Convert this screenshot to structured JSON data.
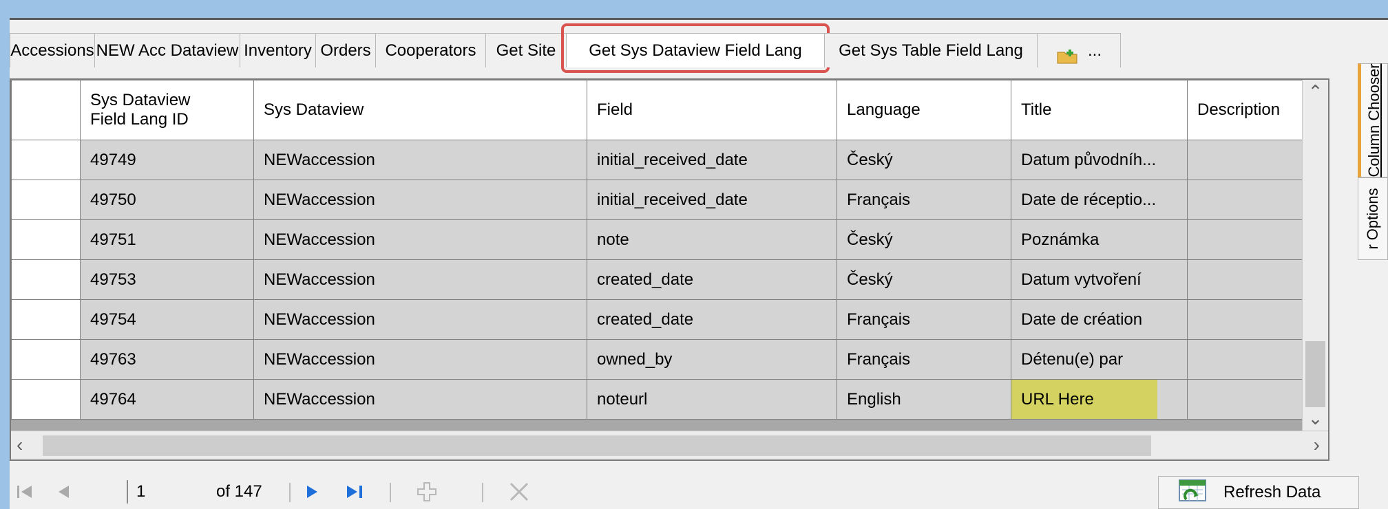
{
  "tabs": [
    {
      "label": "Accessions",
      "active": false
    },
    {
      "label": "NEW Acc Dataview",
      "active": false
    },
    {
      "label": "Inventory",
      "active": false
    },
    {
      "label": "Orders",
      "active": false
    },
    {
      "label": "Cooperators",
      "active": false
    },
    {
      "label": "Get Site",
      "active": false
    },
    {
      "label": "Get Sys Dataview Field Lang",
      "active": true
    },
    {
      "label": "Get Sys Table Field Lang",
      "active": false
    }
  ],
  "tab_overflow_label": "...",
  "grid": {
    "columns": [
      "Sys Dataview\nField Lang ID",
      "Sys Dataview",
      "Field",
      "Language",
      "Title",
      "Description"
    ],
    "rows": [
      [
        "49749",
        "NEWaccession",
        "initial_received_date",
        "Český",
        "Datum původníh...",
        ""
      ],
      [
        "49750",
        "NEWaccession",
        "initial_received_date",
        "Français",
        "Date de réceptio...",
        ""
      ],
      [
        "49751",
        "NEWaccession",
        "note",
        "Český",
        "Poznámka",
        ""
      ],
      [
        "49753",
        "NEWaccession",
        "created_date",
        "Český",
        "Datum vytvoření",
        ""
      ],
      [
        "49754",
        "NEWaccession",
        "created_date",
        "Français",
        "Date de création",
        ""
      ],
      [
        "49763",
        "NEWaccession",
        "owned_by",
        "Français",
        "Détenu(e) par",
        ""
      ],
      [
        "49764",
        "NEWaccession",
        "noteurl",
        "English",
        "URL Here",
        ""
      ]
    ],
    "highlight_color": "#d4d24c"
  },
  "side_tabs": [
    {
      "label": "Column Chooser",
      "active": true
    },
    {
      "label": "r Options",
      "active": false
    }
  ],
  "navigator": {
    "page_value": "1",
    "page_total_label": "of 147",
    "refresh_label": "Refresh Data"
  },
  "colors": {
    "background": "#9cc3e6",
    "panel": "#f0f0f0",
    "selected_tab_outline": "#d9534f",
    "active_side_tab": "#e8a33a",
    "nav_arrow": "#1e6fd9"
  }
}
